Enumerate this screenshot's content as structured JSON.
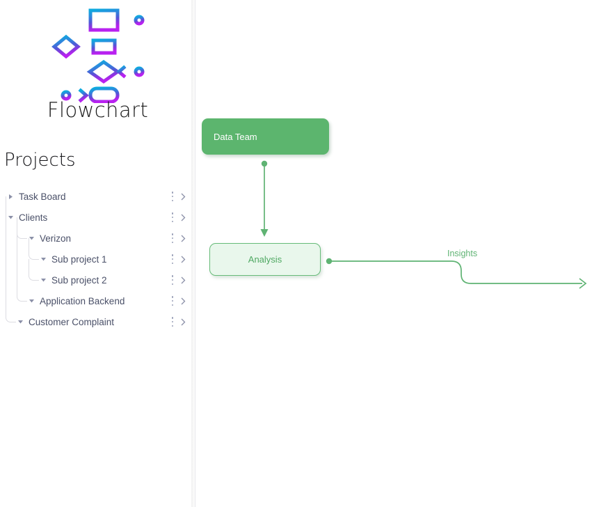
{
  "app": {
    "brand_title": "Flowchart",
    "logo_icon": "flowchart-logo-icon",
    "background_color": "#ffffff"
  },
  "sidebar": {
    "heading": "Projects",
    "divider_color": "#e9e9ec",
    "tree": [
      {
        "label": "Task Board",
        "depth": 0,
        "expanded": false,
        "caret": "caret-right-icon",
        "kebab": "kebab-menu-icon",
        "chevron": "chevron-right-icon"
      },
      {
        "label": "Clients",
        "depth": 0,
        "expanded": true,
        "caret": "caret-down-icon",
        "kebab": "kebab-menu-icon",
        "chevron": "chevron-right-icon"
      },
      {
        "label": "Verizon",
        "depth": 1,
        "expanded": true,
        "caret": "caret-down-icon",
        "kebab": "kebab-menu-icon",
        "chevron": "chevron-right-icon"
      },
      {
        "label": "Sub project 1",
        "depth": 2,
        "expanded": true,
        "caret": "caret-down-icon",
        "kebab": "kebab-menu-icon",
        "chevron": "chevron-right-icon"
      },
      {
        "label": "Sub project 2",
        "depth": 2,
        "expanded": true,
        "caret": "caret-down-icon",
        "kebab": "kebab-menu-icon",
        "chevron": "chevron-right-icon"
      },
      {
        "label": "Application Backend",
        "depth": 1,
        "expanded": true,
        "caret": "caret-down-icon",
        "kebab": "kebab-menu-icon",
        "chevron": "chevron-right-icon"
      },
      {
        "label": "Customer Complaint",
        "depth": 0,
        "expanded": true,
        "caret": "caret-down-icon",
        "kebab": "kebab-menu-icon",
        "chevron": "chevron-right-icon"
      }
    ]
  },
  "canvas": {
    "nodes": [
      {
        "id": "data-team",
        "label": "Data Team",
        "fill": "#5cb56e",
        "text_color": "#ffffff",
        "style": "filled"
      },
      {
        "id": "analysis",
        "label": "Analysis",
        "fill": "#e9f7ec",
        "border_color": "#66bb78",
        "text_color": "#4fa862",
        "style": "outlined"
      }
    ],
    "edges": [
      {
        "id": "data-team-to-analysis",
        "from": "data-team",
        "to": "analysis",
        "label": "",
        "color": "#5fb373",
        "direction": "down"
      },
      {
        "id": "analysis-to-insights",
        "from": "analysis",
        "to": "",
        "label": "Insights",
        "color": "#5fb373",
        "direction": "right"
      }
    ]
  }
}
